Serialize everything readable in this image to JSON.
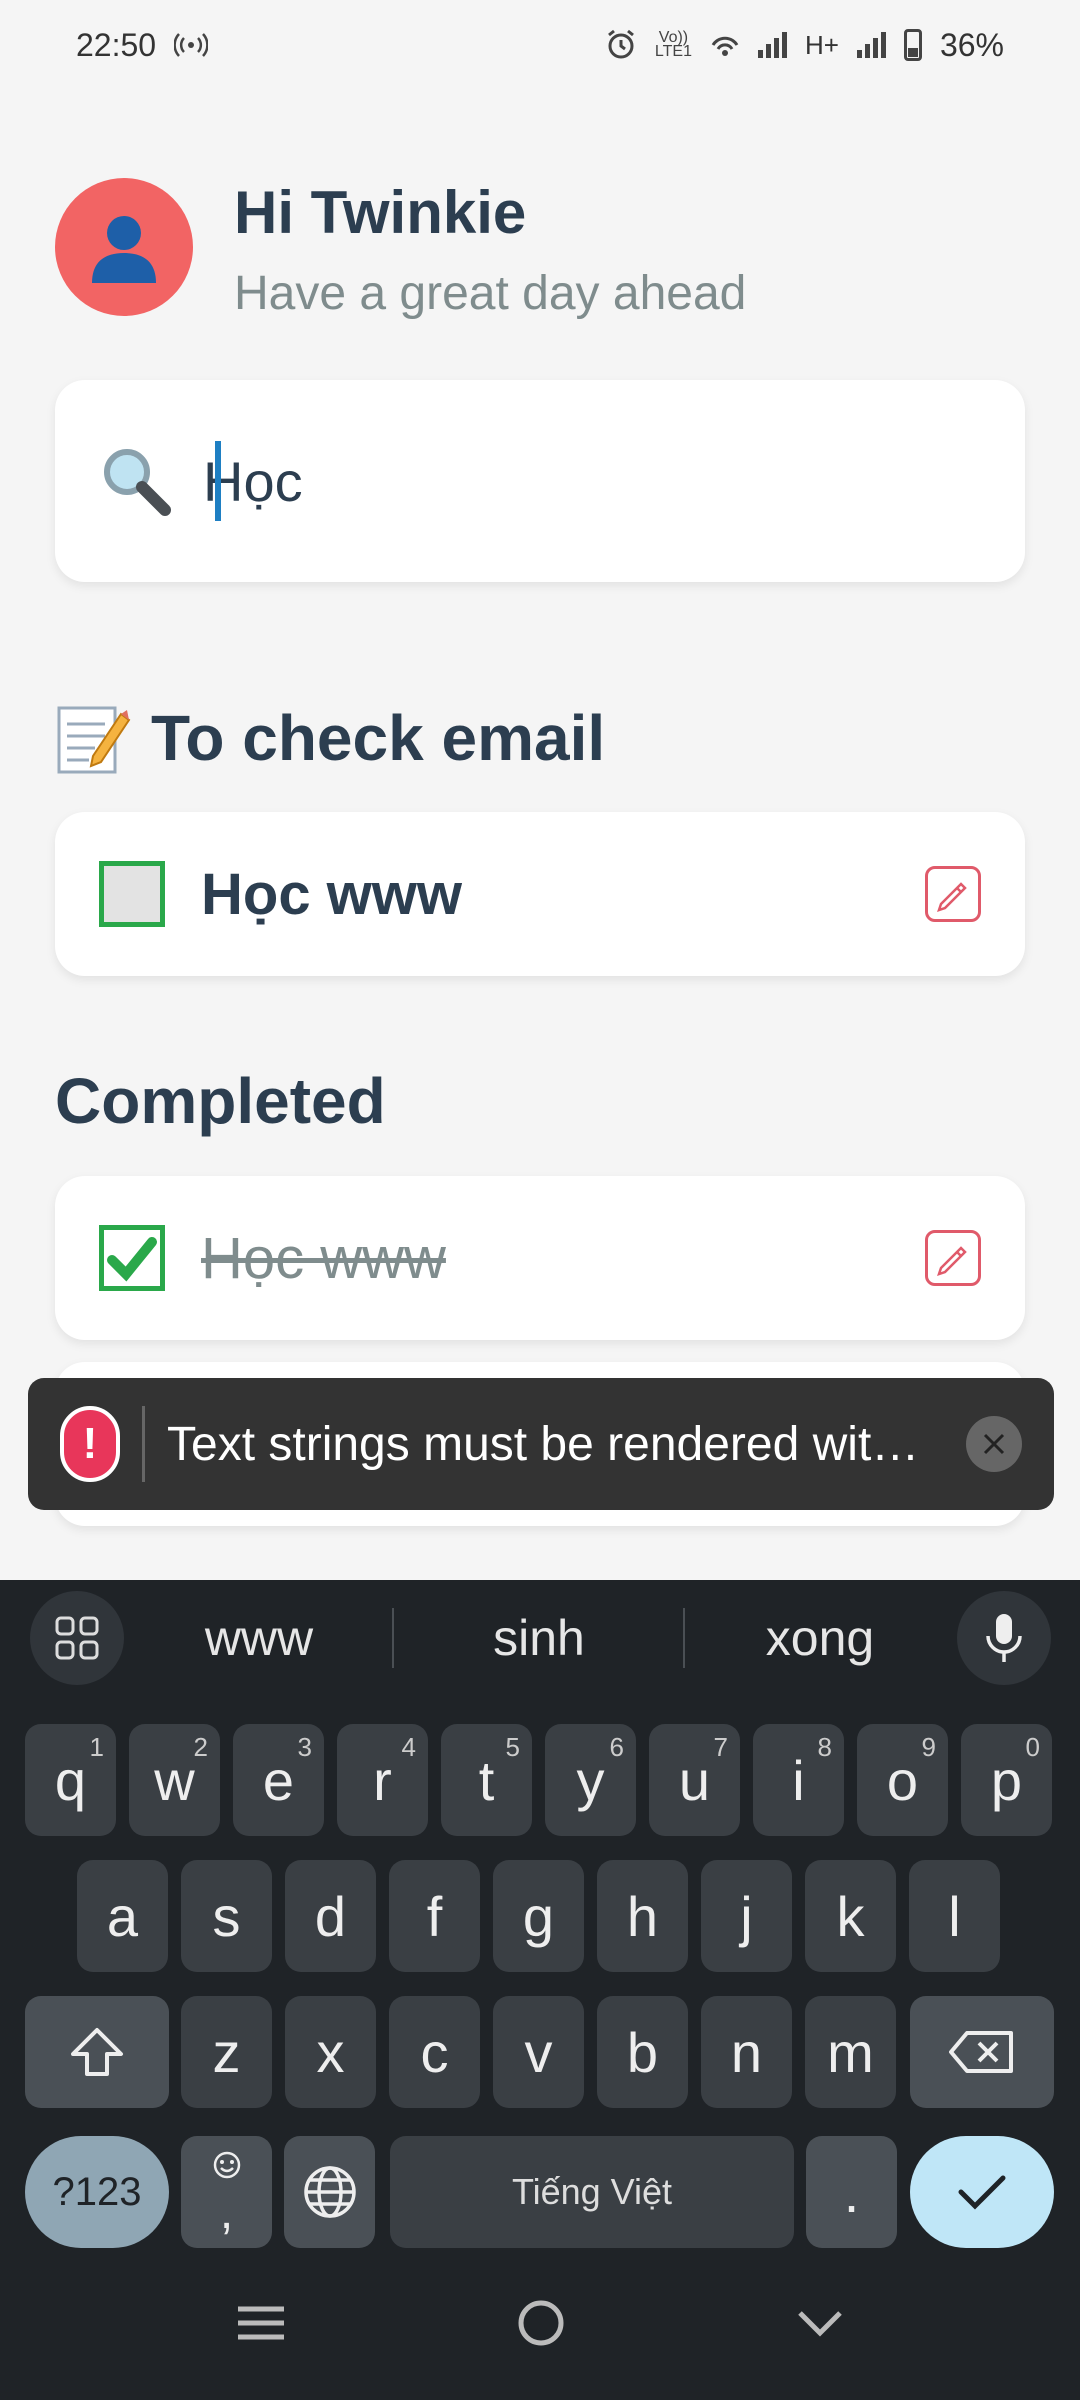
{
  "status_bar": {
    "time": "22:50",
    "battery": "36%",
    "network_type": "H+",
    "icons": [
      "hotspot-icon",
      "alarm-icon",
      "volte-icon",
      "wifi-icon",
      "signal-icon",
      "battery-icon"
    ]
  },
  "header": {
    "greeting": "Hi Twinkie",
    "subtitle": "Have a great day ahead",
    "avatar_icon": "person-icon",
    "avatar_color": "#f26464"
  },
  "search": {
    "value": "Học",
    "icon": "magnifier-icon"
  },
  "sections": {
    "todo_title": "To check email",
    "todo_icon": "memo-icon",
    "completed_title": "Completed"
  },
  "tasks": {
    "todo": [
      {
        "text": "Học www",
        "checked": false
      }
    ],
    "completed": [
      {
        "text": "Học www",
        "checked": true
      }
    ]
  },
  "toast": {
    "message": "Text strings must be rendered wit…",
    "icon": "alert-icon"
  },
  "keyboard": {
    "suggestions": [
      "www",
      "sinh",
      "xong"
    ],
    "row1": [
      {
        "k": "q",
        "n": "1"
      },
      {
        "k": "w",
        "n": "2"
      },
      {
        "k": "e",
        "n": "3"
      },
      {
        "k": "r",
        "n": "4"
      },
      {
        "k": "t",
        "n": "5"
      },
      {
        "k": "y",
        "n": "6"
      },
      {
        "k": "u",
        "n": "7"
      },
      {
        "k": "i",
        "n": "8"
      },
      {
        "k": "o",
        "n": "9"
      },
      {
        "k": "p",
        "n": "0"
      }
    ],
    "row2": [
      "a",
      "s",
      "d",
      "f",
      "g",
      "h",
      "j",
      "k",
      "l"
    ],
    "row3": [
      "z",
      "x",
      "c",
      "v",
      "b",
      "n",
      "m"
    ],
    "symbols_key": "?123",
    "comma_key": ",",
    "space_label": "Tiếng Việt",
    "period_key": "."
  },
  "colors": {
    "accent": "#1e7fc3",
    "check_green": "#2aa84a",
    "edit_red": "#e05a6a",
    "toast_bg": "#333333",
    "keyboard_bg": "#1f2327"
  }
}
